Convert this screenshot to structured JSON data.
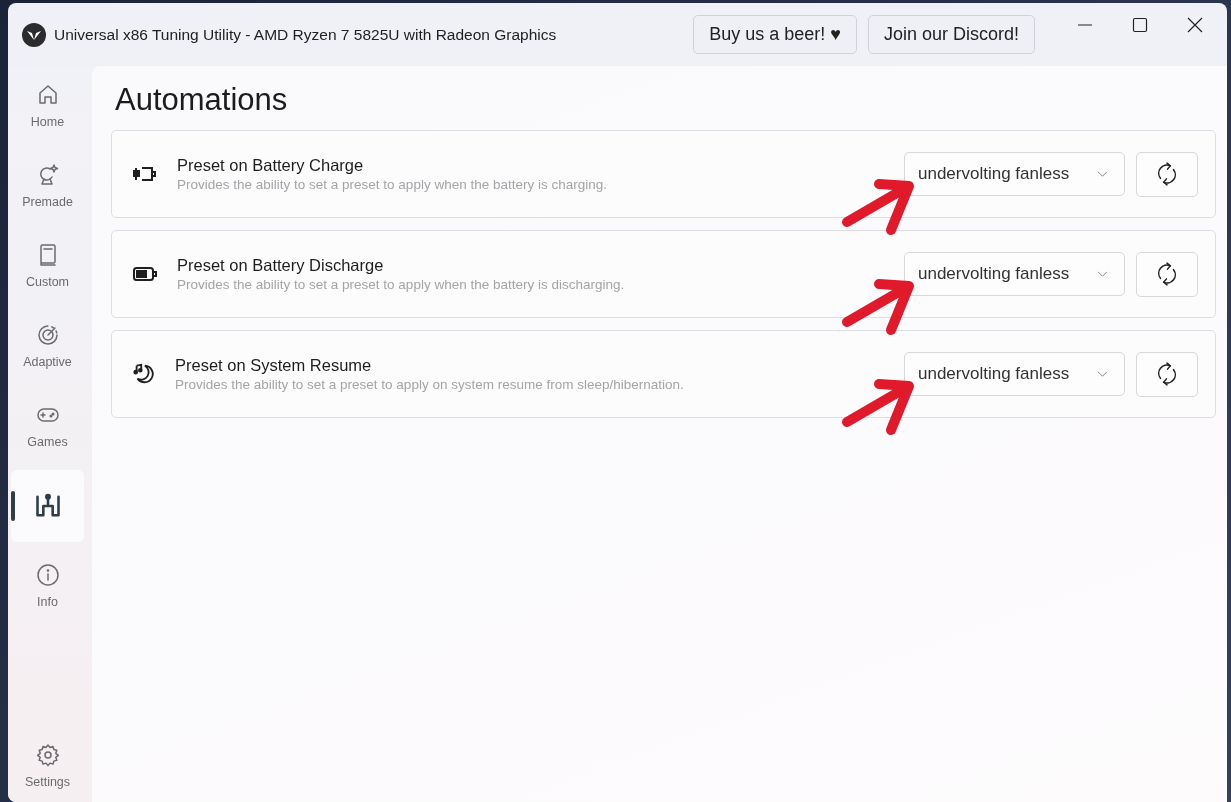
{
  "window": {
    "title": "Universal x86 Tuning Utility - AMD Ryzen 7 5825U with Radeon Graphics"
  },
  "header_buttons": [
    {
      "label": "Buy us a beer! ♥"
    },
    {
      "label": "Join our Discord!"
    }
  ],
  "sidebar": {
    "items": [
      {
        "kind": "home",
        "label": "Home",
        "selected": false
      },
      {
        "kind": "premade",
        "label": "Premade",
        "selected": false
      },
      {
        "kind": "custom",
        "label": "Custom",
        "selected": false
      },
      {
        "kind": "adaptive",
        "label": "Adaptive",
        "selected": false
      },
      {
        "kind": "games",
        "label": "Games",
        "selected": false
      },
      {
        "kind": "automations",
        "selected": true
      },
      {
        "kind": "info",
        "label": "Info",
        "selected": false
      }
    ],
    "footer_items": [
      {
        "kind": "settings",
        "label": "Settings",
        "selected": false
      }
    ]
  },
  "page": {
    "title": "Automations"
  },
  "automations": [
    {
      "kind": "charge",
      "title": "Preset on Battery Charge",
      "description": "Provides the ability to set a preset to apply when the battery is charging.",
      "preset": "undervolting fanless",
      "annotated": true
    },
    {
      "kind": "discharge",
      "title": "Preset on Battery Discharge",
      "description": "Provides the ability to set a preset to apply when the battery is discharging.",
      "preset": "undervolting fanless",
      "annotated": true
    },
    {
      "kind": "resume",
      "title": "Preset on System Resume",
      "description": "Provides the ability to set a preset to apply on system resume from sleep/hibernation.",
      "preset": "undervolting fanless",
      "annotated": true
    }
  ]
}
